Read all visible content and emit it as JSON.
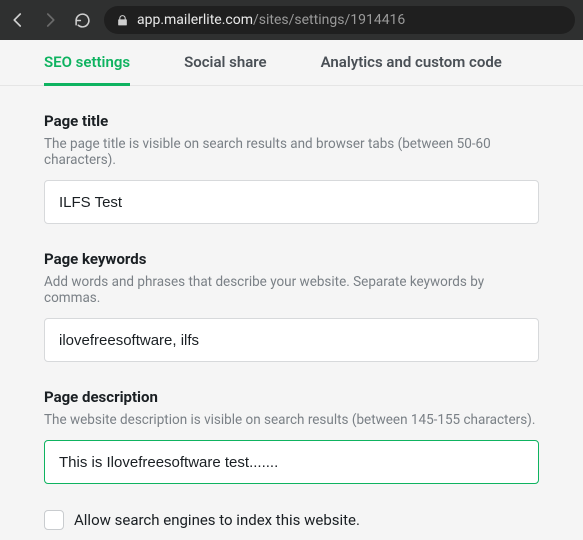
{
  "browser": {
    "url_domain": "app.mailerlite.com",
    "url_path": "/sites/settings/1914416"
  },
  "tabs": {
    "seo": "SEO settings",
    "social": "Social share",
    "analytics": "Analytics and custom code"
  },
  "form": {
    "page_title": {
      "label": "Page title",
      "help": "The page title is visible on search results and browser tabs (between 50-60 characters).",
      "value": "ILFS Test"
    },
    "page_keywords": {
      "label": "Page keywords",
      "help": "Add words and phrases that describe your website. Separate keywords by commas.",
      "value": "ilovefreesoftware, ilfs"
    },
    "page_description": {
      "label": "Page description",
      "help": "The website description is visible on search results (between 145-155 characters).",
      "value": "This is Ilovefreesoftware test......."
    },
    "allow_index": {
      "label": "Allow search engines to index this website."
    }
  }
}
